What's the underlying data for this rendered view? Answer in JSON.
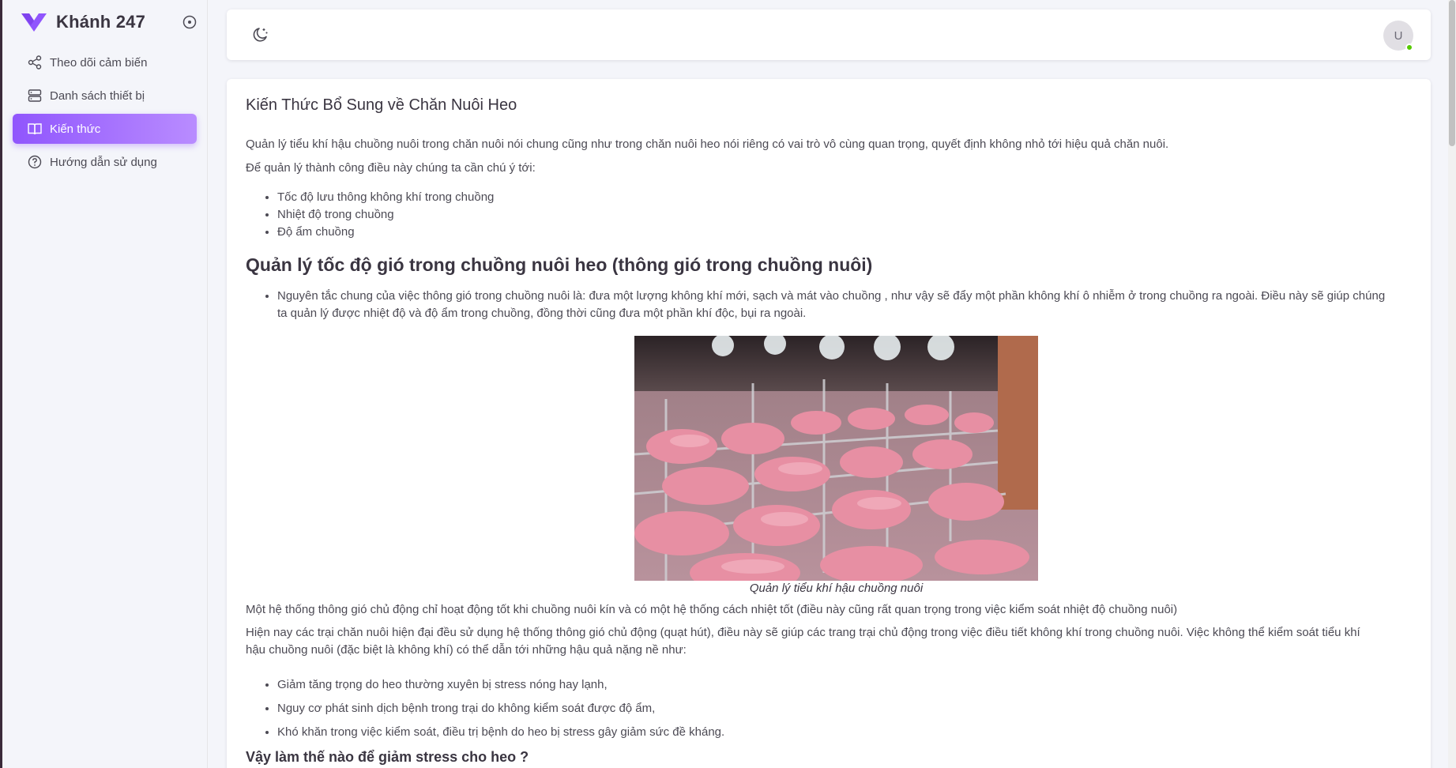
{
  "app": {
    "brand_name": "Khánh 247",
    "accent_color": "#9055fd"
  },
  "sidebar": {
    "items": [
      {
        "label": "Theo dõi cảm biến",
        "icon": "share-nodes-icon",
        "active": false
      },
      {
        "label": "Danh sách thiết bị",
        "icon": "server-icon",
        "active": false
      },
      {
        "label": "Kiến thức",
        "icon": "book-open-icon",
        "active": true
      },
      {
        "label": "Hướng dẫn sử dụng",
        "icon": "help-circle-icon",
        "active": false
      }
    ]
  },
  "header": {
    "avatar_initial": "U",
    "theme_icon": "moon-icon"
  },
  "article": {
    "title": "Kiến Thức Bổ Sung về Chăn Nuôi Heo",
    "intro_1": "Quản lý tiểu khí hậu chuồng nuôi trong chăn nuôi nói chung cũng như trong chăn nuôi heo nói riêng có vai trò vô cùng quan trọng, quyết định không nhỏ tới hiệu quả chăn nuôi.",
    "intro_2": "Để quản lý thành công điều này chúng ta cần chú ý tới:",
    "factors": [
      "Tốc độ lưu thông không khí trong chuồng",
      "Nhiệt độ trong chuồng",
      "Độ ẩm chuồng"
    ],
    "section_heading": "Quản lý tốc độ gió trong chuồng nuôi heo (thông gió trong chuồng nuôi)",
    "principle_line_1": "Nguyên tắc chung của việc thông gió trong chuồng nuôi là: đưa một lượng không khí mới, sạch và mát vào chuồng , như vậy sẽ đẩy một phần không khí ô nhiễm ở trong chuồng ra ngoài. Điều này sẽ giúp chúng",
    "principle_line_2": "ta quản lý được nhiệt độ và độ ẩm trong chuồng, đồng thời cũng đưa một phần khí độc, bụi ra ngoài.",
    "image_caption": "Quản lý tiểu khí hậu chuồng nuôi",
    "para_ventilation": "Một hệ thống thông gió chủ động chỉ hoạt động tốt khi chuồng nuôi kín và có một hệ thống cách nhiệt tốt (điều này cũng rất quan trọng trong việc kiểm soát nhiệt độ chuồng nuôi)",
    "para_modern_1": "Hiện nay các trại chăn nuôi hiện đại đều sử dụng hệ thống thông gió chủ động (quạt hút), điều này sẽ giúp các trang trại chủ động trong việc điều tiết không khí trong chuồng nuôi. Việc không thể kiểm soát tiểu khí",
    "para_modern_2": "hậu chuồng nuôi (đặc biệt là không khí) có thể dẫn tới những hậu quả nặng nề như:",
    "consequences": [
      "Giảm tăng trọng do heo thường xuyên bị stress nóng hay lạnh,",
      "Nguy cơ phát sinh dịch bệnh trong trại do không kiểm soát được độ ẩm,",
      "Khó khăn trong việc kiểm soát, điều trị bệnh do heo bị stress gây giảm sức đề kháng."
    ],
    "stress_heading": "Vậy làm thế nào để giảm stress cho heo ?"
  }
}
